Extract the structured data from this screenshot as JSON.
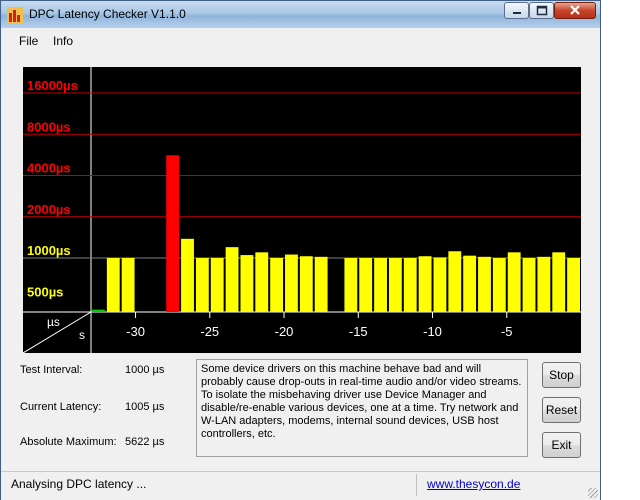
{
  "window": {
    "title": "DPC Latency Checker V1.1.0"
  },
  "menu": {
    "items": [
      "File",
      "Info"
    ]
  },
  "chart_data": {
    "type": "bar",
    "y_scale": "log2",
    "y_tick_labels": [
      "16000µs",
      "8000µs",
      "4000µs",
      "2000µs",
      "1000µs",
      "500µs"
    ],
    "y_tick_values": [
      16000,
      8000,
      4000,
      2000,
      1000,
      500
    ],
    "ylabel": "µs",
    "xlabel": "s",
    "x_tick_labels": [
      "-30",
      "-25",
      "-20",
      "-15",
      "-10",
      "-5"
    ],
    "xlim": [
      -33,
      0
    ],
    "ylim": [
      250,
      16000
    ],
    "thresholds": {
      "green_below": 1000,
      "red_at_or_above": 2000
    },
    "values": [
      420,
      1000,
      1000,
      320,
      360,
      5622,
      1380,
      1000,
      1000,
      1200,
      1050,
      1100,
      1000,
      1060,
      1030,
      1020,
      380,
      1000,
      1000,
      1000,
      1000,
      1000,
      1030,
      1010,
      1120,
      1040,
      1020,
      1000,
      1100,
      1000,
      1020,
      1100,
      1000
    ],
    "colors": {
      "green": "#00d000",
      "yellow": "#ffff00",
      "red": "#ff0000",
      "grid": "#c00000",
      "axis_text": "#ffffff",
      "label_red": "#ff0000",
      "label_yellow": "#ffff00"
    }
  },
  "stats": {
    "test_interval_label": "Test Interval:",
    "test_interval_value": "1000 µs",
    "current_latency_label": "Current Latency:",
    "current_latency_value": "1005 µs",
    "absolute_max_label": "Absolute Maximum:",
    "absolute_max_value": "5622 µs"
  },
  "info_text": "Some device drivers on this machine behave bad and will probably cause drop-outs in real-time audio and/or video streams. To isolate the misbehaving driver use Device Manager and disable/re-enable various devices, one at a time. Try network and W-LAN adapters, modems, internal sound devices, USB host controllers, etc.",
  "buttons": {
    "stop": "Stop",
    "reset": "Reset",
    "exit": "Exit"
  },
  "status": {
    "text": "Analysing DPC latency ...",
    "link": "www.thesycon.de"
  }
}
